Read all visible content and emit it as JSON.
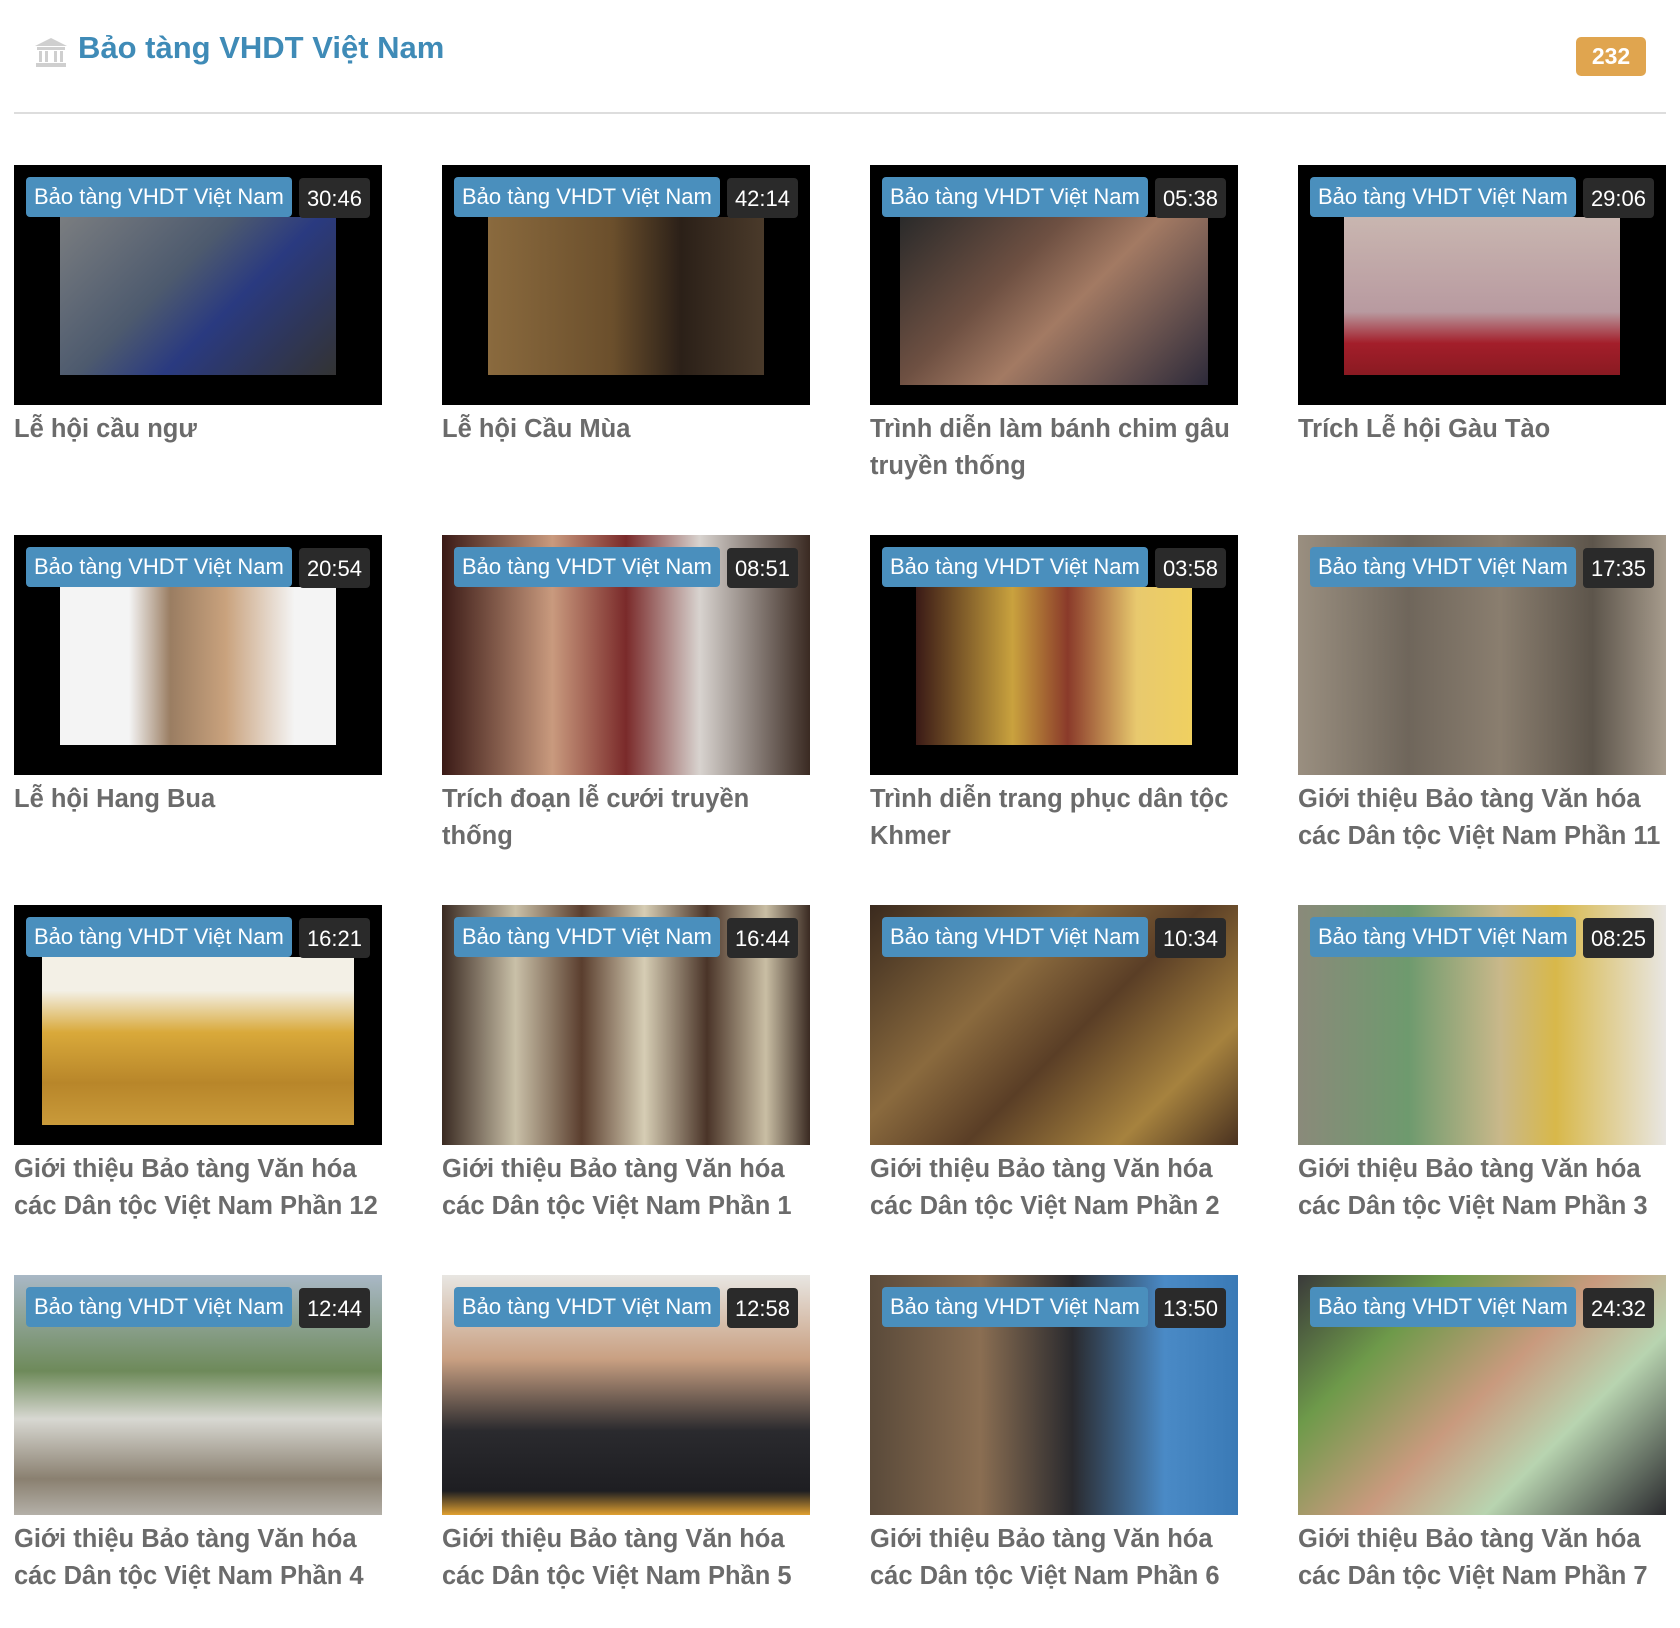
{
  "header": {
    "title": "Bảo tàng VHDT Việt Nam",
    "icon": "museum-icon",
    "count": "232"
  },
  "colors": {
    "accent": "#3f8bb7",
    "channel_tag": "#4a8fbd",
    "badge": "#e0a54f",
    "duration_bg": "#2a2a2a",
    "title_text": "#6b6b6b"
  },
  "videos": [
    {
      "channel": "Bảo tàng VHDT Việt Nam",
      "duration": "30:46",
      "title": "Lễ hội cầu ngư"
    },
    {
      "channel": "Bảo tàng VHDT Việt Nam",
      "duration": "42:14",
      "title": "Lễ hội Cầu Mùa"
    },
    {
      "channel": "Bảo tàng VHDT Việt Nam",
      "duration": "05:38",
      "title": "Trình diễn làm bánh chim gâu truyền thống"
    },
    {
      "channel": "Bảo tàng VHDT Việt Nam",
      "duration": "29:06",
      "title": "Trích Lễ hội Gàu Tào"
    },
    {
      "channel": "Bảo tàng VHDT Việt Nam",
      "duration": "20:54",
      "title": "Lễ hội Hang Bua"
    },
    {
      "channel": "Bảo tàng VHDT Việt Nam",
      "duration": "08:51",
      "title": "Trích đoạn lễ cưới truyền thống"
    },
    {
      "channel": "Bảo tàng VHDT Việt Nam",
      "duration": "03:58",
      "title": "Trình diễn trang phục dân tộc Khmer"
    },
    {
      "channel": "Bảo tàng VHDT Việt Nam",
      "duration": "17:35",
      "title": "Giới thiệu Bảo tàng Văn hóa các Dân tộc Việt Nam Phần 11"
    },
    {
      "channel": "Bảo tàng VHDT Việt Nam",
      "duration": "16:21",
      "title": "Giới thiệu Bảo tàng Văn hóa các Dân tộc Việt Nam Phần 12"
    },
    {
      "channel": "Bảo tàng VHDT Việt Nam",
      "duration": "16:44",
      "title": "Giới thiệu Bảo tàng Văn hóa các Dân tộc Việt Nam Phần 1"
    },
    {
      "channel": "Bảo tàng VHDT Việt Nam",
      "duration": "10:34",
      "title": "Giới thiệu Bảo tàng Văn hóa các Dân tộc Việt Nam Phần 2"
    },
    {
      "channel": "Bảo tàng VHDT Việt Nam",
      "duration": "08:25",
      "title": "Giới thiệu Bảo tàng Văn hóa các Dân tộc Việt Nam Phần 3"
    },
    {
      "channel": "Bảo tàng VHDT Việt Nam",
      "duration": "12:44",
      "title": "Giới thiệu Bảo tàng Văn hóa các Dân tộc Việt Nam Phần 4"
    },
    {
      "channel": "Bảo tàng VHDT Việt Nam",
      "duration": "12:58",
      "title": "Giới thiệu Bảo tàng Văn hóa các Dân tộc Việt Nam Phần 5"
    },
    {
      "channel": "Bảo tàng VHDT Việt Nam",
      "duration": "13:50",
      "title": "Giới thiệu Bảo tàng Văn hóa các Dân tộc Việt Nam Phần 6"
    },
    {
      "channel": "Bảo tàng VHDT Việt Nam",
      "duration": "24:32",
      "title": "Giới thiệu Bảo tàng Văn hóa các Dân tộc Việt Nam Phần 7"
    }
  ]
}
